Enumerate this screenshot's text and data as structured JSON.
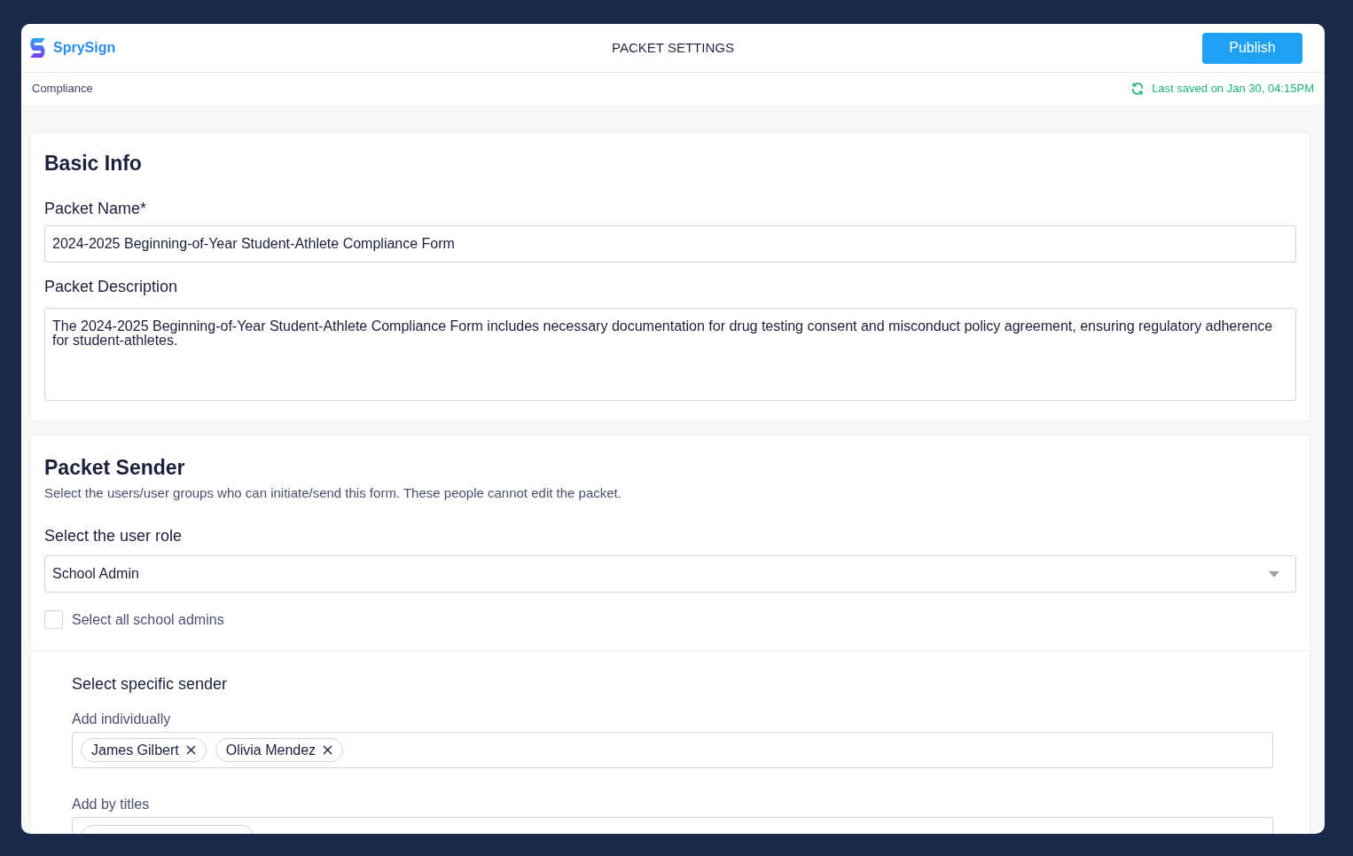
{
  "header": {
    "brand": "SprySign",
    "title": "PACKET SETTINGS",
    "publish_button": "Publish"
  },
  "subbar": {
    "breadcrumb": "Compliance",
    "saved_status": "Last saved on Jan 30, 04:15PM"
  },
  "basic_info": {
    "heading": "Basic Info",
    "name_label": "Packet Name*",
    "name_value": "2024-2025 Beginning-of-Year Student-Athlete Compliance Form",
    "description_label": "Packet Description",
    "description_value": "The 2024-2025 Beginning-of-Year Student-Athlete Compliance Form includes necessary documentation for drug testing consent and misconduct policy agreement, ensuring regulatory adherence for student-athletes."
  },
  "packet_sender": {
    "heading": "Packet Sender",
    "subtitle": "Select the users/user groups who can initiate/send this form. These people cannot edit the packet.",
    "role_label": "Select the user role",
    "role_value": "School Admin",
    "select_all": {
      "label": "Select all school admins",
      "checked": false
    },
    "specific_heading": "Select specific sender",
    "individual_label": "Add individually",
    "individuals": [
      "James Gilbert",
      "Olivia Mendez"
    ],
    "titles_label": "Add by titles"
  }
}
